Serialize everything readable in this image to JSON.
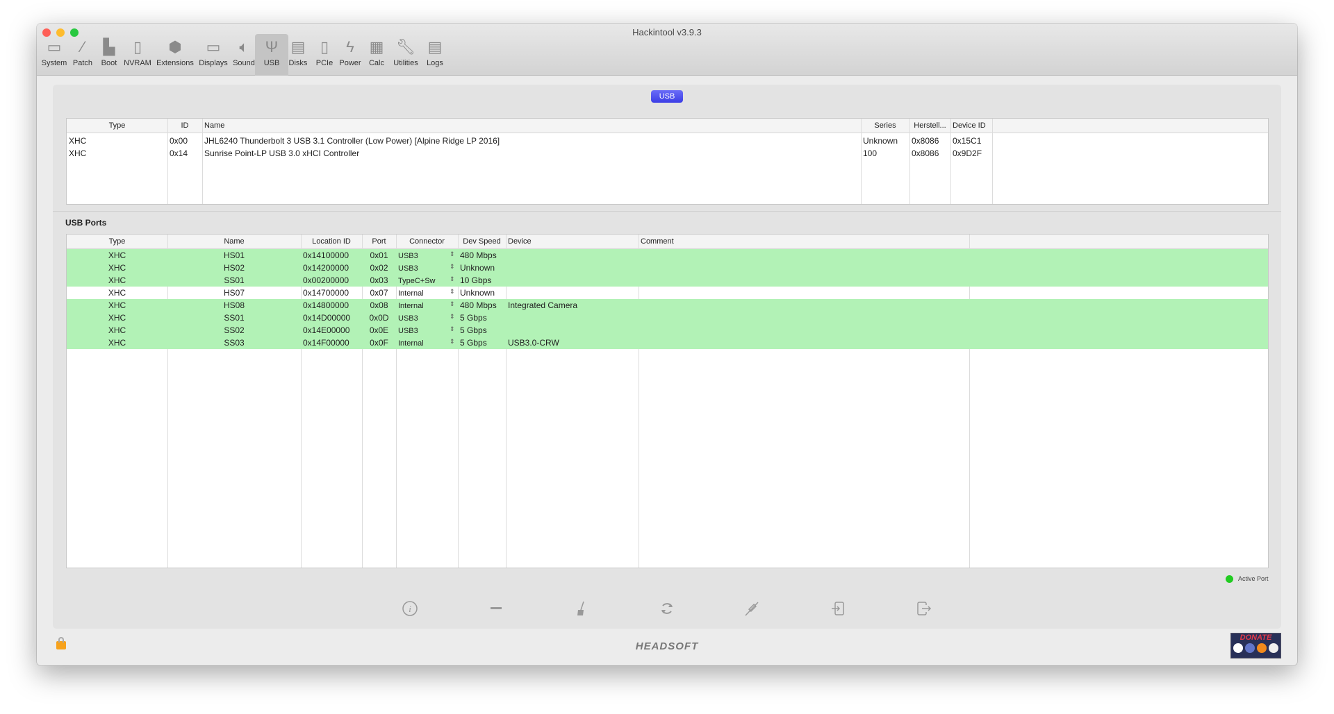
{
  "window": {
    "title": "Hackintool v3.9.3"
  },
  "toolbar": [
    {
      "label": "System",
      "icon": "computer-icon",
      "glyph": "▭"
    },
    {
      "label": "Patch",
      "icon": "bandage-icon",
      "glyph": "⁄"
    },
    {
      "label": "Boot",
      "icon": "boot-icon",
      "glyph": "▙"
    },
    {
      "label": "NVRAM",
      "icon": "memory-icon",
      "glyph": "▯"
    },
    {
      "label": "Extensions",
      "icon": "lego-icon",
      "glyph": "⬢"
    },
    {
      "label": "Displays",
      "icon": "display-icon",
      "glyph": "▭"
    },
    {
      "label": "Sound",
      "icon": "speaker-icon",
      "glyph": "🔈︎"
    },
    {
      "label": "USB",
      "icon": "usb-icon",
      "glyph": "Ψ"
    },
    {
      "label": "Disks",
      "icon": "disk-icon",
      "glyph": "▤"
    },
    {
      "label": "PCIe",
      "icon": "pcie-icon",
      "glyph": "▯"
    },
    {
      "label": "Power",
      "icon": "power-icon",
      "glyph": "ϟ"
    },
    {
      "label": "Calc",
      "icon": "calculator-icon",
      "glyph": "▦"
    },
    {
      "label": "Utilities",
      "icon": "wrench-icon",
      "glyph": "🔧︎"
    },
    {
      "label": "Logs",
      "icon": "logs-icon",
      "glyph": "▤"
    }
  ],
  "usb_button": "USB",
  "controllers": {
    "headers": [
      "Type",
      "ID",
      "Name",
      "Series",
      "Herstell...",
      "Device ID"
    ],
    "rows": [
      [
        "XHC",
        "0x00",
        "JHL6240 Thunderbolt 3 USB 3.1 Controller (Low Power) [Alpine Ridge LP 2016]",
        "Unknown",
        "0x8086",
        "0x15C1"
      ],
      [
        "XHC",
        "0x14",
        "Sunrise Point-LP USB 3.0 xHCI Controller",
        "100",
        "0x8086",
        "0x9D2F"
      ]
    ]
  },
  "ports": {
    "title": "USB Ports",
    "headers": [
      "Type",
      "Name",
      "Location ID",
      "Port",
      "Connector",
      "Dev Speed",
      "Device",
      "Comment"
    ],
    "rows": [
      {
        "active": true,
        "cells": [
          "XHC",
          "HS01",
          "0x14100000",
          "0x01",
          "USB3",
          "480 Mbps",
          "",
          ""
        ]
      },
      {
        "active": true,
        "cells": [
          "XHC",
          "HS02",
          "0x14200000",
          "0x02",
          "USB3",
          "Unknown",
          "",
          ""
        ]
      },
      {
        "active": true,
        "cells": [
          "XHC",
          "SS01",
          "0x00200000",
          "0x03",
          "TypeC+Sw",
          "10 Gbps",
          "",
          ""
        ]
      },
      {
        "active": false,
        "cells": [
          "XHC",
          "HS07",
          "0x14700000",
          "0x07",
          "Internal",
          "Unknown",
          "",
          ""
        ]
      },
      {
        "active": true,
        "cells": [
          "XHC",
          "HS08",
          "0x14800000",
          "0x08",
          "Internal",
          "480 Mbps",
          "Integrated Camera",
          ""
        ]
      },
      {
        "active": true,
        "cells": [
          "XHC",
          "SS01",
          "0x14D00000",
          "0x0D",
          "USB3",
          "5 Gbps",
          "",
          ""
        ]
      },
      {
        "active": true,
        "cells": [
          "XHC",
          "SS02",
          "0x14E00000",
          "0x0E",
          "USB3",
          "5 Gbps",
          "",
          ""
        ]
      },
      {
        "active": true,
        "cells": [
          "XHC",
          "SS03",
          "0x14F00000",
          "0x0F",
          "Internal",
          "5 Gbps",
          "USB3.0-CRW",
          ""
        ]
      }
    ]
  },
  "legend": {
    "label": "Active Port",
    "color": "#22cc22"
  },
  "actions": [
    "info",
    "remove",
    "clear",
    "refresh",
    "inject",
    "import",
    "export"
  ],
  "footer": {
    "brand": "HEADSOFT",
    "donate": "DONATE"
  }
}
